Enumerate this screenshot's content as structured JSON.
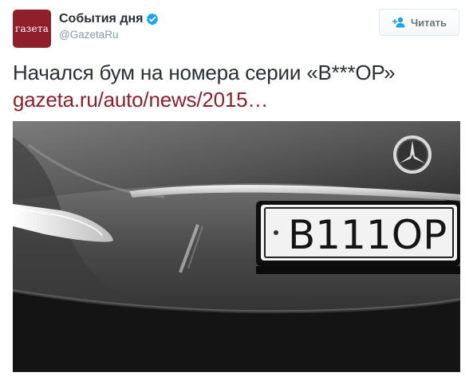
{
  "account": {
    "avatar_text": "газета",
    "display_name": "События дня",
    "handle": "@GazetaRu",
    "verified": true
  },
  "follow_button": {
    "label": "Читать",
    "icon": "add-user-icon"
  },
  "tweet": {
    "text": "Начался бум на номера серии «В***ОР»",
    "link": "gazeta.ru/auto/news/2015…"
  },
  "media": {
    "plate_number": "В111ОР",
    "brand_logo": "mercedes-star-icon"
  },
  "colors": {
    "brand": "#8f1f2b",
    "verified": "#1da1f2",
    "muted": "#8899a6"
  }
}
